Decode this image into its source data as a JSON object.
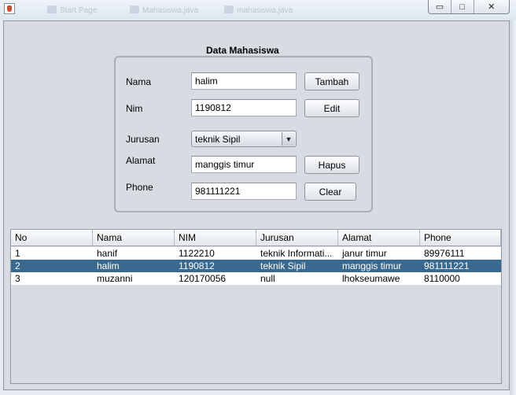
{
  "window": {
    "taskbar_tabs": [
      "Start Page",
      "Mahasiswa.java",
      "mahasiswa.java"
    ],
    "controls": {
      "minimize": "▭",
      "maximize": "□",
      "close": "✕"
    }
  },
  "form": {
    "title": "Data Mahasiswa",
    "labels": {
      "nama": "Nama",
      "nim": "Nim",
      "jurusan": "Jurusan",
      "alamat": "Alamat",
      "phone": "Phone"
    },
    "values": {
      "nama": "halim",
      "nim": "1190812",
      "jurusan": "teknik Sipil",
      "alamat": "manggis timur",
      "phone": "981111221"
    },
    "buttons": {
      "tambah": "Tambah",
      "edit": "Edit",
      "hapus": "Hapus",
      "clear": "Clear"
    }
  },
  "table": {
    "columns": [
      "No",
      "Nama",
      "NIM",
      "Jurusan",
      "Alamat",
      "Phone"
    ],
    "rows": [
      [
        "1",
        "hanif",
        "1122210",
        "teknik Informati...",
        "janur timur",
        "89976111"
      ],
      [
        "2",
        "halim",
        "1190812",
        "teknik Sipil",
        "manggis timur",
        "981111221"
      ],
      [
        "3",
        "muzanni",
        "120170056",
        "null",
        "lhokseumawe",
        "8110000"
      ]
    ],
    "selected_row": 1
  },
  "colors": {
    "selection": "#39698f",
    "window_bg": "#d8dbe1"
  }
}
